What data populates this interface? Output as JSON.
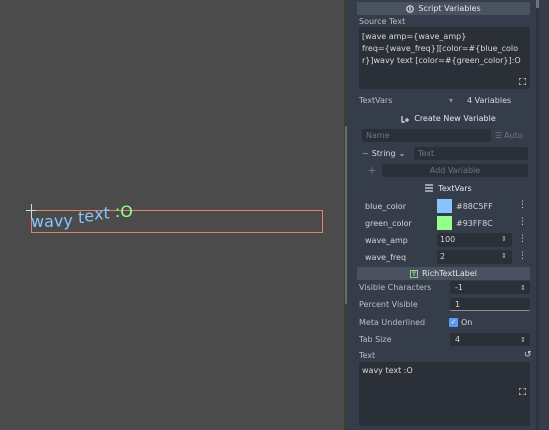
{
  "viewport": {
    "wavy_segments": [
      {
        "text": "wavy text ",
        "color": "#88c5ff"
      },
      {
        "text": ":O",
        "color": "#93ff8c"
      }
    ]
  },
  "inspector": {
    "script_variables_header": "Script Variables",
    "source_text_label": "Source Text",
    "source_text_lines": [
      "[wave amp={wave_amp}",
      "freq={wave_freq}][color=#{blue_colo",
      "r}]wavy text [color=#{green_color}]:O"
    ],
    "textvars_label": "TextVars",
    "textvars_count": "4 Variables",
    "create_variable_label": "Create New Variable",
    "name_placeholder": "Name",
    "auto_label": "Auto",
    "type_label": "String",
    "text_placeholder": "Text",
    "add_variable_label": "Add Variable",
    "textvars_section": "TextVars",
    "variables": [
      {
        "name": "blue_color",
        "value": "#88C5FF",
        "swatch": "#88c5ff"
      },
      {
        "name": "green_color",
        "value": "#93FF8C",
        "swatch": "#93ff8c"
      },
      {
        "name": "wave_amp",
        "value": "100"
      },
      {
        "name": "wave_freq",
        "value": "2"
      }
    ],
    "richtextlabel_header": "RichTextLabel",
    "properties": {
      "visible_characters_label": "Visible Characters",
      "visible_characters_value": "-1",
      "percent_visible_label": "Percent Visible",
      "percent_visible_value": "1",
      "meta_underlined_label": "Meta Underlined",
      "meta_underlined_value": "On",
      "tab_size_label": "Tab Size",
      "tab_size_value": "4",
      "text_label": "Text",
      "text_value": "wavy text :O"
    }
  }
}
